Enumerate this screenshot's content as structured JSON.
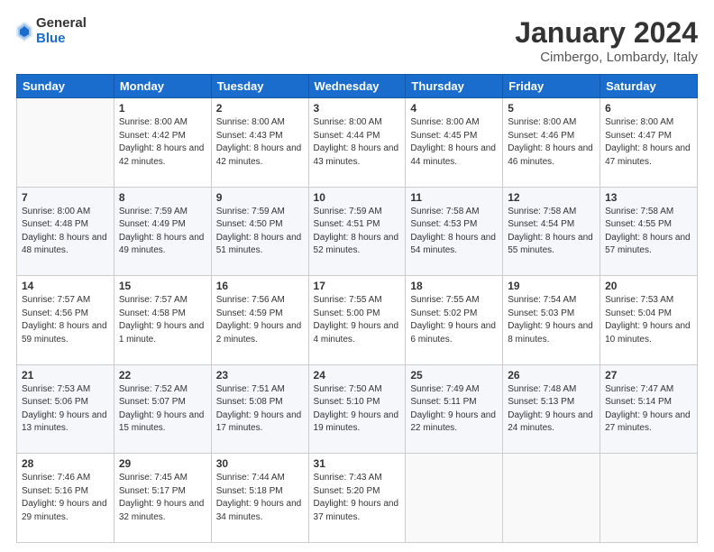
{
  "header": {
    "logo_general": "General",
    "logo_blue": "Blue",
    "month_title": "January 2024",
    "location": "Cimbergo, Lombardy, Italy"
  },
  "weekdays": [
    "Sunday",
    "Monday",
    "Tuesday",
    "Wednesday",
    "Thursday",
    "Friday",
    "Saturday"
  ],
  "weeks": [
    [
      {
        "day": "",
        "sunrise": "",
        "sunset": "",
        "daylight": ""
      },
      {
        "day": "1",
        "sunrise": "8:00 AM",
        "sunset": "4:42 PM",
        "daylight": "8 hours and 42 minutes."
      },
      {
        "day": "2",
        "sunrise": "8:00 AM",
        "sunset": "4:43 PM",
        "daylight": "8 hours and 42 minutes."
      },
      {
        "day": "3",
        "sunrise": "8:00 AM",
        "sunset": "4:44 PM",
        "daylight": "8 hours and 43 minutes."
      },
      {
        "day": "4",
        "sunrise": "8:00 AM",
        "sunset": "4:45 PM",
        "daylight": "8 hours and 44 minutes."
      },
      {
        "day": "5",
        "sunrise": "8:00 AM",
        "sunset": "4:46 PM",
        "daylight": "8 hours and 46 minutes."
      },
      {
        "day": "6",
        "sunrise": "8:00 AM",
        "sunset": "4:47 PM",
        "daylight": "8 hours and 47 minutes."
      }
    ],
    [
      {
        "day": "7",
        "sunrise": "8:00 AM",
        "sunset": "4:48 PM",
        "daylight": "8 hours and 48 minutes."
      },
      {
        "day": "8",
        "sunrise": "7:59 AM",
        "sunset": "4:49 PM",
        "daylight": "8 hours and 49 minutes."
      },
      {
        "day": "9",
        "sunrise": "7:59 AM",
        "sunset": "4:50 PM",
        "daylight": "8 hours and 51 minutes."
      },
      {
        "day": "10",
        "sunrise": "7:59 AM",
        "sunset": "4:51 PM",
        "daylight": "8 hours and 52 minutes."
      },
      {
        "day": "11",
        "sunrise": "7:58 AM",
        "sunset": "4:53 PM",
        "daylight": "8 hours and 54 minutes."
      },
      {
        "day": "12",
        "sunrise": "7:58 AM",
        "sunset": "4:54 PM",
        "daylight": "8 hours and 55 minutes."
      },
      {
        "day": "13",
        "sunrise": "7:58 AM",
        "sunset": "4:55 PM",
        "daylight": "8 hours and 57 minutes."
      }
    ],
    [
      {
        "day": "14",
        "sunrise": "7:57 AM",
        "sunset": "4:56 PM",
        "daylight": "8 hours and 59 minutes."
      },
      {
        "day": "15",
        "sunrise": "7:57 AM",
        "sunset": "4:58 PM",
        "daylight": "9 hours and 1 minute."
      },
      {
        "day": "16",
        "sunrise": "7:56 AM",
        "sunset": "4:59 PM",
        "daylight": "9 hours and 2 minutes."
      },
      {
        "day": "17",
        "sunrise": "7:55 AM",
        "sunset": "5:00 PM",
        "daylight": "9 hours and 4 minutes."
      },
      {
        "day": "18",
        "sunrise": "7:55 AM",
        "sunset": "5:02 PM",
        "daylight": "9 hours and 6 minutes."
      },
      {
        "day": "19",
        "sunrise": "7:54 AM",
        "sunset": "5:03 PM",
        "daylight": "9 hours and 8 minutes."
      },
      {
        "day": "20",
        "sunrise": "7:53 AM",
        "sunset": "5:04 PM",
        "daylight": "9 hours and 10 minutes."
      }
    ],
    [
      {
        "day": "21",
        "sunrise": "7:53 AM",
        "sunset": "5:06 PM",
        "daylight": "9 hours and 13 minutes."
      },
      {
        "day": "22",
        "sunrise": "7:52 AM",
        "sunset": "5:07 PM",
        "daylight": "9 hours and 15 minutes."
      },
      {
        "day": "23",
        "sunrise": "7:51 AM",
        "sunset": "5:08 PM",
        "daylight": "9 hours and 17 minutes."
      },
      {
        "day": "24",
        "sunrise": "7:50 AM",
        "sunset": "5:10 PM",
        "daylight": "9 hours and 19 minutes."
      },
      {
        "day": "25",
        "sunrise": "7:49 AM",
        "sunset": "5:11 PM",
        "daylight": "9 hours and 22 minutes."
      },
      {
        "day": "26",
        "sunrise": "7:48 AM",
        "sunset": "5:13 PM",
        "daylight": "9 hours and 24 minutes."
      },
      {
        "day": "27",
        "sunrise": "7:47 AM",
        "sunset": "5:14 PM",
        "daylight": "9 hours and 27 minutes."
      }
    ],
    [
      {
        "day": "28",
        "sunrise": "7:46 AM",
        "sunset": "5:16 PM",
        "daylight": "9 hours and 29 minutes."
      },
      {
        "day": "29",
        "sunrise": "7:45 AM",
        "sunset": "5:17 PM",
        "daylight": "9 hours and 32 minutes."
      },
      {
        "day": "30",
        "sunrise": "7:44 AM",
        "sunset": "5:18 PM",
        "daylight": "9 hours and 34 minutes."
      },
      {
        "day": "31",
        "sunrise": "7:43 AM",
        "sunset": "5:20 PM",
        "daylight": "9 hours and 37 minutes."
      },
      {
        "day": "",
        "sunrise": "",
        "sunset": "",
        "daylight": ""
      },
      {
        "day": "",
        "sunrise": "",
        "sunset": "",
        "daylight": ""
      },
      {
        "day": "",
        "sunrise": "",
        "sunset": "",
        "daylight": ""
      }
    ]
  ],
  "labels": {
    "sunrise": "Sunrise:",
    "sunset": "Sunset:",
    "daylight": "Daylight:"
  }
}
